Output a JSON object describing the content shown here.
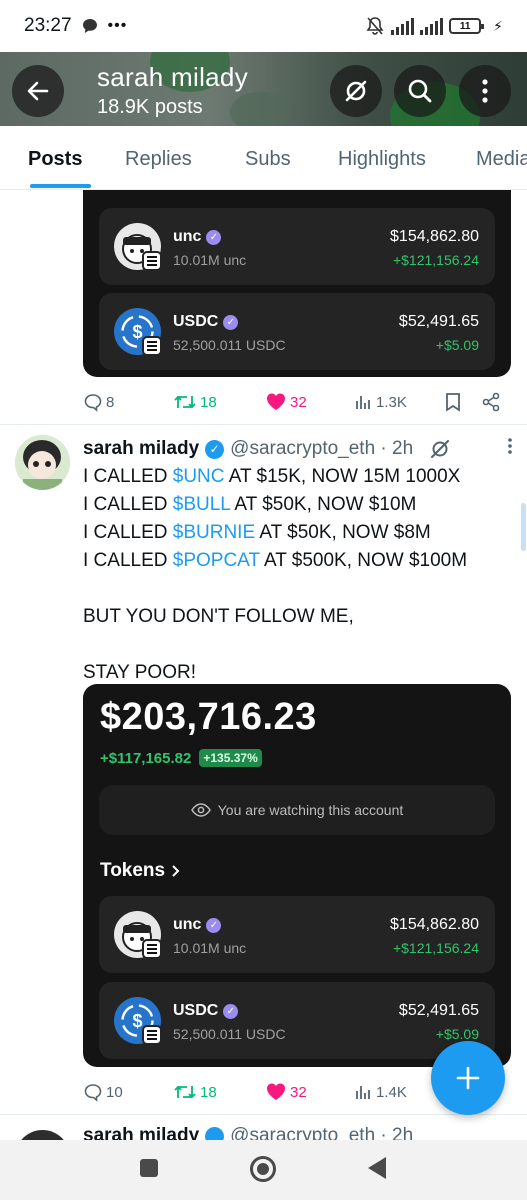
{
  "status_bar": {
    "time": "23:27",
    "battery": "11"
  },
  "header": {
    "title": "sarah milady",
    "subtitle": "18.9K posts"
  },
  "tabs": [
    {
      "label": "Posts",
      "active": true
    },
    {
      "label": "Replies"
    },
    {
      "label": "Subs"
    },
    {
      "label": "Highlights"
    },
    {
      "label": "Media"
    }
  ],
  "card1": {
    "tokens": [
      {
        "name": "unc",
        "amount": "10.01M unc",
        "value": "$154,862.80",
        "change": "+$121,156.24"
      },
      {
        "name": "USDC",
        "amount": "52,500.011 USDC",
        "value": "$52,491.65",
        "change": "+$5.09"
      }
    ]
  },
  "post1_actions": {
    "replies": "8",
    "reposts": "18",
    "likes": "32",
    "views": "1.3K"
  },
  "post": {
    "name": "sarah milady",
    "handle": "@saracrypto_eth",
    "time": "2h",
    "lines": [
      {
        "pre": "I CALLED ",
        "tag": "$UNC",
        "post": " AT $15K, NOW 15M 1000X"
      },
      {
        "pre": "I CALLED ",
        "tag": "$BULL",
        "post": " AT $50K, NOW $10M"
      },
      {
        "pre": "I CALLED ",
        "tag": "$BURNIE",
        "post": " AT $50K, NOW $8M"
      },
      {
        "pre": "I CALLED ",
        "tag": "$POPCAT",
        "post": " AT $500K, NOW $100M"
      }
    ],
    "line_follow": "BUT YOU DON'T FOLLOW ME,",
    "line_stay": "STAY POOR!"
  },
  "card2": {
    "balance": "$203,716.23",
    "pnl": "+$117,165.82",
    "pnl_pct": "+135.37%",
    "watching": "You are watching this account",
    "tokens_heading": "Tokens",
    "tokens": [
      {
        "name": "unc",
        "amount": "10.01M unc",
        "value": "$154,862.80",
        "change": "+$121,156.24"
      },
      {
        "name": "USDC",
        "amount": "52,500.011 USDC",
        "value": "$52,491.65",
        "change": "+$5.09"
      }
    ]
  },
  "post2_actions": {
    "replies": "10",
    "reposts": "18",
    "likes": "32",
    "views": "1.4K"
  },
  "next_post": {
    "name": "sarah milady",
    "handle": "@saracrypto_eth",
    "time": "2h"
  },
  "colors": {
    "accent": "#1d9bf0",
    "repost": "#00ba7c",
    "like": "#f91880",
    "gain": "#31c46b"
  }
}
